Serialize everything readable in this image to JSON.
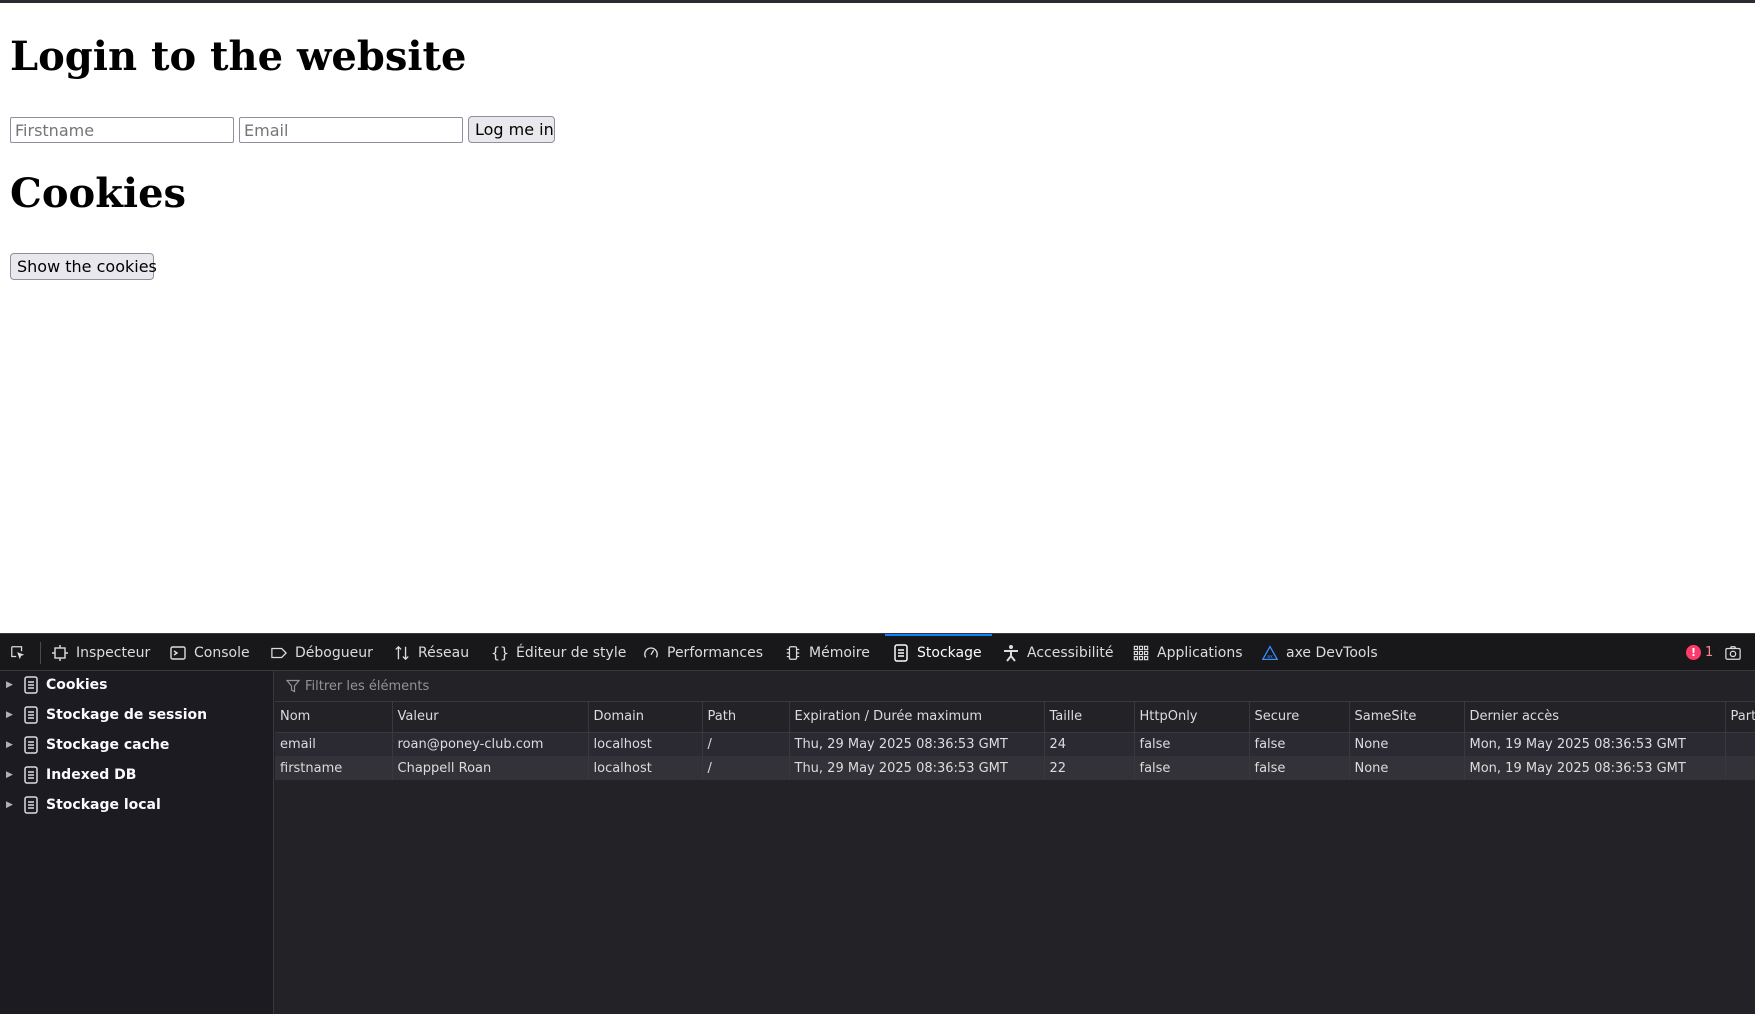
{
  "page": {
    "login_title": "Login to the website",
    "firstname_placeholder": "Firstname",
    "email_placeholder": "Email",
    "login_button": "Log me in",
    "cookies_title": "Cookies",
    "show_cookies_button": "Show the cookies"
  },
  "devtools": {
    "tabs": [
      {
        "label": "Inspecteur",
        "icon": "inspector-icon"
      },
      {
        "label": "Console",
        "icon": "console-icon"
      },
      {
        "label": "Débogueur",
        "icon": "debugger-icon"
      },
      {
        "label": "Réseau",
        "icon": "network-icon"
      },
      {
        "label": "Éditeur de style",
        "icon": "style-editor-icon"
      },
      {
        "label": "Performances",
        "icon": "performance-icon"
      },
      {
        "label": "Mémoire",
        "icon": "memory-icon"
      },
      {
        "label": "Stockage",
        "icon": "storage-icon",
        "active": true
      },
      {
        "label": "Accessibilité",
        "icon": "accessibility-icon"
      },
      {
        "label": "Applications",
        "icon": "applications-icon"
      },
      {
        "label": "axe DevTools",
        "icon": "axe-icon"
      }
    ],
    "error_count": "1",
    "accent_color": "#0a84ff",
    "sidebar": {
      "items": [
        {
          "label": "Cookies"
        },
        {
          "label": "Stockage de session"
        },
        {
          "label": "Stockage cache"
        },
        {
          "label": "Indexed DB"
        },
        {
          "label": "Stockage local"
        }
      ]
    },
    "filter_placeholder": "Filtrer les éléments",
    "table": {
      "columns": [
        "Nom",
        "Valeur",
        "Domain",
        "Path",
        "Expiration / Durée maximum",
        "Taille",
        "HttpOnly",
        "Secure",
        "SameSite",
        "Dernier accès",
        "Part"
      ],
      "rows": [
        [
          "email",
          "roan@poney-club.com",
          "localhost",
          "/",
          "Thu, 29 May 2025 08:36:53 GMT",
          "24",
          "false",
          "false",
          "None",
          "Mon, 19 May 2025 08:36:53 GMT",
          ""
        ],
        [
          "firstname",
          "Chappell Roan",
          "localhost",
          "/",
          "Thu, 29 May 2025 08:36:53 GMT",
          "22",
          "false",
          "false",
          "None",
          "Mon, 19 May 2025 08:36:53 GMT",
          ""
        ]
      ]
    }
  }
}
